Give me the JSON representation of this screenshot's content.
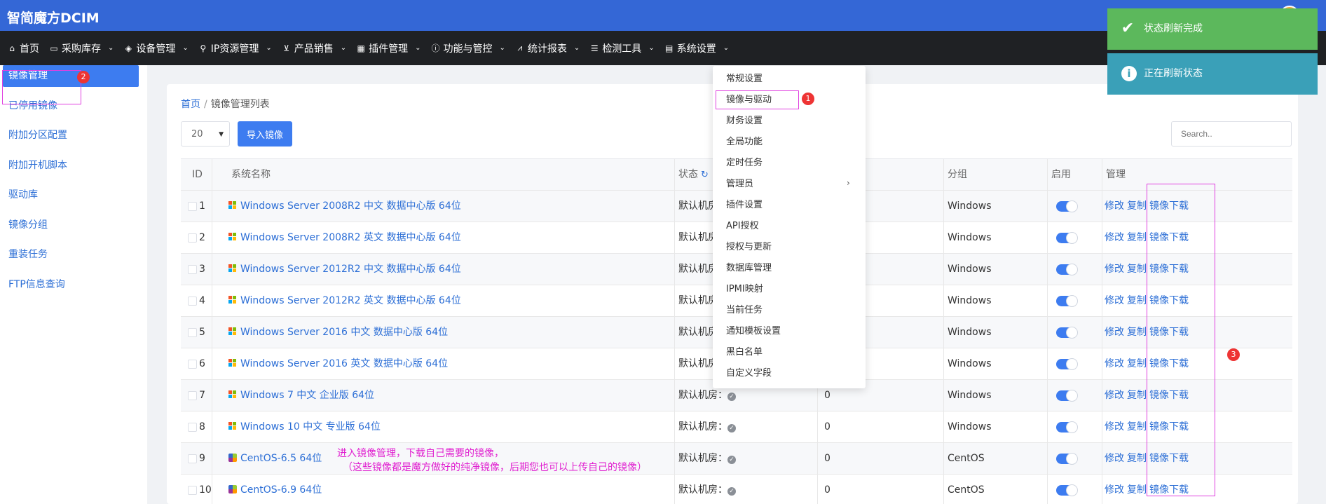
{
  "brand": "智简魔方DCIM",
  "nav": [
    {
      "icon": "home-icon",
      "glyph": "⌂",
      "label": "首页",
      "chev": false
    },
    {
      "icon": "hdd-icon",
      "glyph": "▭",
      "label": "采购库存",
      "chev": true
    },
    {
      "icon": "cube-icon",
      "glyph": "◈",
      "label": "设备管理",
      "chev": true
    },
    {
      "icon": "location-icon",
      "glyph": "⚲",
      "label": "IP资源管理",
      "chev": true
    },
    {
      "icon": "cart-icon",
      "glyph": "⊻",
      "label": "产品销售",
      "chev": true
    },
    {
      "icon": "grid-icon",
      "glyph": "▦",
      "label": "插件管理",
      "chev": true
    },
    {
      "icon": "info-icon",
      "glyph": "ⓘ",
      "label": "功能与管控",
      "chev": true
    },
    {
      "icon": "chart-icon",
      "glyph": "⩘",
      "label": "统计报表",
      "chev": true
    },
    {
      "icon": "list-icon",
      "glyph": "☰",
      "label": "检测工具",
      "chev": true
    },
    {
      "icon": "table-icon",
      "glyph": "▤",
      "label": "系统设置",
      "chev": true
    }
  ],
  "sidebar": [
    {
      "label": "镜像管理",
      "active": true
    },
    {
      "label": "已停用镜像"
    },
    {
      "label": "附加分区配置"
    },
    {
      "label": "附加开机脚本"
    },
    {
      "label": "驱动库"
    },
    {
      "label": "镜像分组"
    },
    {
      "label": "重装任务"
    },
    {
      "label": "FTP信息查询"
    }
  ],
  "breadcrumb": {
    "home": "首页",
    "sep": "/",
    "current": "镜像管理列表"
  },
  "toolbar": {
    "page_size": "20",
    "import_label": "导入镜像",
    "search_placeholder": "Search.."
  },
  "table": {
    "headers": {
      "id": "ID",
      "name": "系统名称",
      "status": "状态",
      "col4": "",
      "group": "分组",
      "enabled": "启用",
      "manage": "管理"
    },
    "actions": {
      "edit": "修改",
      "copy": "复制",
      "download": "镜像下载"
    },
    "rows": [
      {
        "id": "1",
        "os": "windows",
        "name": "Windows Server 2008R2 中文 数据中心版 64位",
        "status": "默认机房：",
        "count": "",
        "group": "Windows"
      },
      {
        "id": "2",
        "os": "windows",
        "name": "Windows Server 2008R2 英文 数据中心版 64位",
        "status": "默认机房：",
        "count": "",
        "group": "Windows"
      },
      {
        "id": "3",
        "os": "windows",
        "name": "Windows Server 2012R2 中文 数据中心版 64位",
        "status": "默认机房：",
        "count": "",
        "group": "Windows"
      },
      {
        "id": "4",
        "os": "windows",
        "name": "Windows Server 2012R2 英文 数据中心版 64位",
        "status": "默认机房：",
        "count": "",
        "group": "Windows"
      },
      {
        "id": "5",
        "os": "windows",
        "name": "Windows Server 2016 中文 数据中心版 64位",
        "status": "默认机房：",
        "count": "",
        "group": "Windows"
      },
      {
        "id": "6",
        "os": "windows",
        "name": "Windows Server 2016 英文 数据中心版 64位",
        "status": "默认机房：",
        "count": "",
        "group": "Windows"
      },
      {
        "id": "7",
        "os": "windows",
        "name": "Windows 7 中文 企业版 64位",
        "status": "默认机房：",
        "count": "0",
        "group": "Windows"
      },
      {
        "id": "8",
        "os": "windows",
        "name": "Windows 10 中文 专业版 64位",
        "status": "默认机房：",
        "count": "0",
        "group": "Windows"
      },
      {
        "id": "9",
        "os": "centos",
        "name": "CentOS-6.5 64位",
        "status": "默认机房：",
        "count": "0",
        "group": "CentOS"
      },
      {
        "id": "10",
        "os": "centos",
        "name": "CentOS-6.9 64位",
        "status": "默认机房：",
        "count": "0",
        "group": "CentOS"
      }
    ]
  },
  "dropdown": [
    "常规设置",
    "镜像与驱动",
    "财务设置",
    "全局功能",
    "定时任务",
    "管理员",
    "插件设置",
    "API授权",
    "授权与更新",
    "数据库管理",
    "IPMI映射",
    "当前任务",
    "通知模板设置",
    "黑白名单",
    "自定义字段"
  ],
  "toasts": {
    "success": "状态刷新完成",
    "info": "正在刷新状态"
  },
  "annotations": {
    "badge1": "1",
    "badge2": "2",
    "badge3": "3",
    "note_line1": "进入镜像管理，下载自己需要的镜像，",
    "note_line2": "（这些镜像都是魔方做好的纯净镜像，后期您也可以上传自己的镜像）"
  },
  "colors": {
    "brand_bar": "#3467d6",
    "nav_bg": "#1f2124",
    "accent": "#3d7cf0",
    "annotation": "#e040e0",
    "badge": "#ee3434"
  }
}
